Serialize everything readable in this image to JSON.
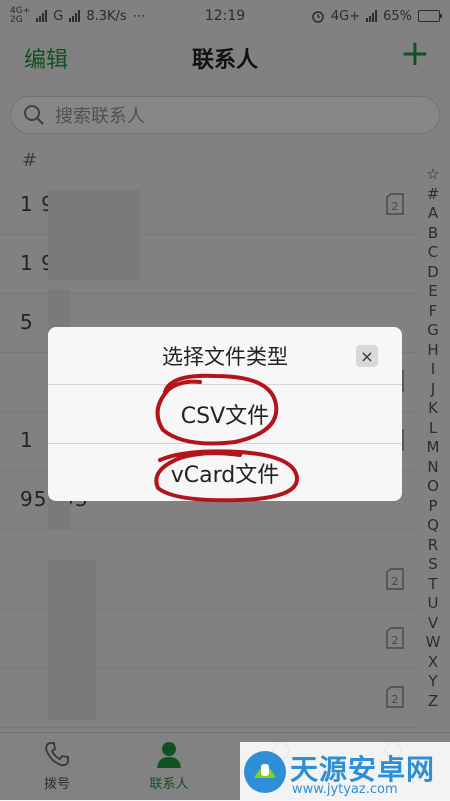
{
  "status_bar": {
    "network_left_top": "4G+",
    "network_left_bottom": "2G",
    "carrier_g": "G",
    "speed": "8.3K/s",
    "dots": "⋯",
    "time": "12:19",
    "network_right": "4G+",
    "battery": "65%",
    "battery_level": 0.65
  },
  "header": {
    "edit_label": "编辑",
    "title": "联系人",
    "add_label": "+"
  },
  "search": {
    "placeholder": "搜索联系人"
  },
  "section_header": "#",
  "contacts": [
    {
      "name": "1         9"
    },
    {
      "name": "1         9"
    },
    {
      "name": "5"
    },
    {
      "name": ""
    },
    {
      "name": "1"
    },
    {
      "name": "95593"
    },
    {
      "name": ""
    },
    {
      "name": ""
    },
    {
      "name": ""
    }
  ],
  "index_letters": [
    "☆",
    "#",
    "A",
    "B",
    "C",
    "D",
    "E",
    "F",
    "G",
    "H",
    "I",
    "J",
    "K",
    "L",
    "M",
    "N",
    "O",
    "P",
    "Q",
    "R",
    "S",
    "T",
    "U",
    "V",
    "W",
    "X",
    "Y",
    "Z"
  ],
  "tabs": [
    {
      "label": "拨号",
      "icon": "phone-icon"
    },
    {
      "label": "联系人",
      "icon": "person-icon",
      "active": true
    },
    {
      "label": "",
      "icon": "tab-icon"
    },
    {
      "label": "",
      "icon": "tab-icon"
    }
  ],
  "dialog": {
    "title": "选择文件类型",
    "close": "×",
    "options": [
      "CSV文件",
      "vCard文件"
    ]
  },
  "watermark": {
    "text": "天源安卓网",
    "url": "www.jytyaz.com"
  },
  "colors": {
    "accent": "#1f9a43",
    "annotation": "#b3141c",
    "watermark": "#2f8fd6"
  }
}
